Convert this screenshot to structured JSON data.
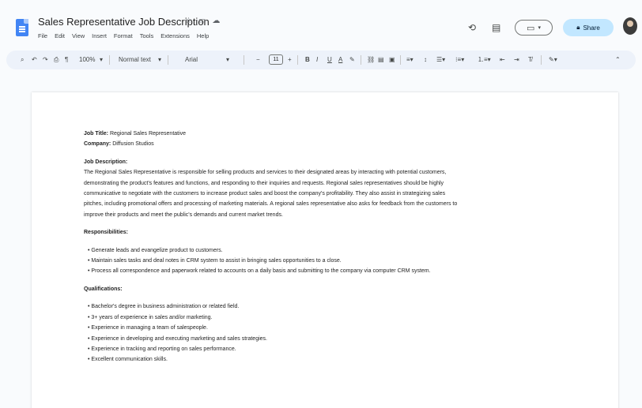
{
  "document": {
    "title": "Sales Representative Job Description",
    "menu": [
      "File",
      "Edit",
      "View",
      "Insert",
      "Format",
      "Tools",
      "Extensions",
      "Help"
    ]
  },
  "header_actions": {
    "share_label": "Share"
  },
  "toolbar": {
    "zoom": "100%",
    "style": "Normal text",
    "font": "Arial",
    "font_size": "11"
  },
  "content": {
    "job_title_label": "Job Title:",
    "job_title_value": "Regional Sales Representative",
    "company_label": "Company:",
    "company_value": "Diffusion Studios",
    "description_heading": "Job Description:",
    "description_lines": [
      "The Regional Sales Representative is responsible for selling products and services to their designated areas by interacting with potential customers,",
      "demonstrating the product's features and functions, and responding to their inquiries and requests. Regional sales representatives should be highly",
      "communicative to negotiate with the customers to increase product sales and boost the company's profitability. They also assist in strategizing sales",
      "pitches, including promotional offers and processing of marketing materials. A regional sales representative also asks for feedback from the customers to",
      "improve their products and meet the public's demands and current market trends."
    ],
    "responsibilities_heading": "Responsibilities:",
    "responsibilities": [
      "Generate leads and evangelize product to customers.",
      "Maintain sales tasks and deal notes in CRM system to assist in bringing sales opportunities to a close.",
      "Process all correspondence and paperwork related to accounts on a daily basis and submitting to the company via computer CRM system."
    ],
    "qualifications_heading": "Qualifications:",
    "qualifications": [
      "Bachelor's degree in business administration or related field.",
      "3+ years of experience in sales and/or marketing.",
      "Experience in managing a team of salespeople.",
      "Experience in developing and executing marketing and sales strategies.",
      "Experience in tracking and reporting on sales performance.",
      "Excellent communication skills."
    ]
  }
}
